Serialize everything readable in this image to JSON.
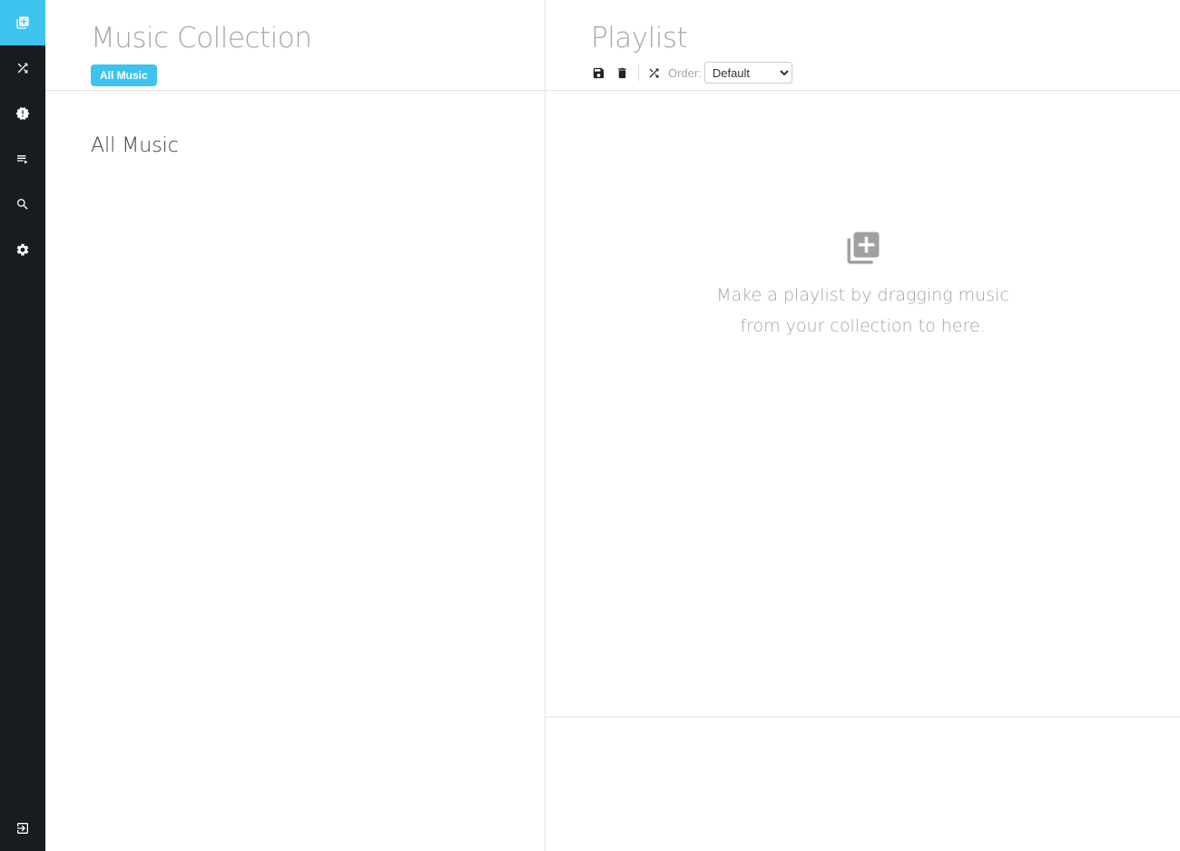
{
  "sidebar": {
    "items": [
      {
        "name": "collection",
        "icon": "library-icon",
        "active": true
      },
      {
        "name": "shuffle",
        "icon": "shuffle-icon",
        "active": false
      },
      {
        "name": "alerts",
        "icon": "alert-badge-icon",
        "active": false
      },
      {
        "name": "queue",
        "icon": "queue-icon",
        "active": false
      },
      {
        "name": "search",
        "icon": "search-icon",
        "active": false
      },
      {
        "name": "settings",
        "icon": "gear-icon",
        "active": false
      }
    ],
    "logout_icon": "logout-icon"
  },
  "collection": {
    "title": "Music Collection",
    "tag": "All Music",
    "heading": "All Music"
  },
  "playlist": {
    "title": "Playlist",
    "order_label": "Order:",
    "order_value": "Default",
    "empty_line1": "Make a playlist by dragging music",
    "empty_line2": "from your collection to here."
  },
  "colors": {
    "accent": "#3cc3ee",
    "sidebar_bg": "#181b20",
    "muted_text": "#a7a7a7"
  }
}
